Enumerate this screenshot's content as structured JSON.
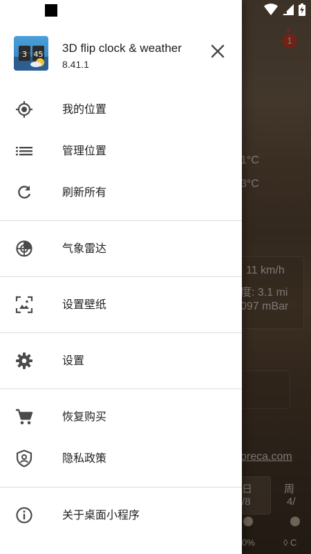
{
  "app": {
    "name": "3D flip clock & weather",
    "version": "8.41.1",
    "icon_clock_left": "3",
    "icon_clock_right": "45"
  },
  "drawer": {
    "items": [
      {
        "label": "我的位置",
        "icon": "my-location-icon"
      },
      {
        "label": "管理位置",
        "icon": "list-icon"
      },
      {
        "label": "刷新所有",
        "icon": "refresh-icon"
      },
      {
        "label": "气象雷达",
        "icon": "radar-icon"
      },
      {
        "label": "设置壁纸",
        "icon": "wallpaper-icon"
      },
      {
        "label": "设置",
        "icon": "settings-gear-icon"
      },
      {
        "label": "恢复购买",
        "icon": "shopping-cart-icon"
      },
      {
        "label": "隐私政策",
        "icon": "privacy-shield-icon"
      },
      {
        "label": "关于桌面小程序",
        "icon": "info-icon"
      }
    ]
  },
  "background": {
    "alert_count": "1",
    "temp_1": "1°C",
    "temp_2": "3°C",
    "wind": "11 km/h",
    "visibility": "度: 3.1 mi",
    "pressure": "097 mBar",
    "link": "oreca.com",
    "day_1": "日",
    "date_1": "/8",
    "day_2": "周",
    "date_2": "4/",
    "precip_1": "0%",
    "precip_2": "◊ C"
  },
  "colors": {
    "drawer_bg": "#ffffff",
    "icon_color": "#4a4a4a",
    "text_color": "#212121",
    "divider": "#dcdcdc",
    "alert": "#c7402d"
  }
}
